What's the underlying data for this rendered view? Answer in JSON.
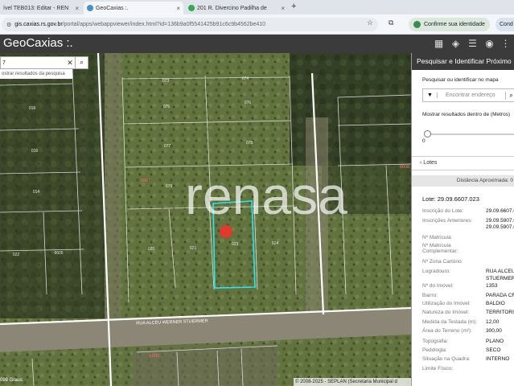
{
  "browser": {
    "tabs": [
      {
        "label": "ível TEB013: Editar - REN"
      },
      {
        "label": "GeoCaxias :."
      },
      {
        "label": "201 R. Divercino Padilha de"
      }
    ],
    "url_domain": "gis.caxias.rs.gov.br",
    "url_path": "/portal/apps/webappviewer/index.html?id=136b9a0f5541425b91c6c9b4562be410",
    "confirm_identity": "Confirme sua identidade",
    "cond_label": "Cond"
  },
  "app": {
    "title": "GeoCaxias :.",
    "search_value": "7",
    "search_suggestion": "ostrar resultados da pesquisa",
    "copyright": "© 2008-2025 - SEPLAN (Secretaria Municipal d",
    "scale_text": "098 Graus",
    "watermark": "renasa",
    "street_label": "RUA ALCEU WERNER STUERMER",
    "map_labels": [
      "073",
      "074",
      "075",
      "076",
      "077",
      "078",
      "079",
      "6607",
      "020",
      "021",
      "022",
      "023",
      "024",
      "6609",
      "018",
      "016",
      "014",
      "6605",
      "6608"
    ]
  },
  "panel": {
    "title": "Pesquisar e Identificar Próximo",
    "search_label": "Pesquisar ou identificar no mapa",
    "search_placeholder": "Encontrar endereço",
    "distance_label": "Mostrar resultados dentro de (Metros)",
    "slider_value": "0",
    "lotes_label": "Lotes",
    "distance_header": "Distância Aproximada: 0",
    "lote_title": "Lote: 29.09.6607.023",
    "rows": [
      {
        "k": "Inscrição do Lote:",
        "v": "29.09.6607.0"
      },
      {
        "k": "Inscrições Anteriores:",
        "v": "29.09.5907.0"
      },
      {
        "k": "",
        "v": "29.09.5907.0"
      },
      {
        "k": "Nº Matrícula:",
        "v": ""
      },
      {
        "k": "Nº Matrícula",
        "v": ""
      },
      {
        "k": "Complementar:",
        "v": ""
      },
      {
        "k": "Nº Zona Cartório:",
        "v": ""
      },
      {
        "k": "Logradouro:",
        "v": "RUA ALCEU"
      },
      {
        "k": "",
        "v": "STUERMER"
      },
      {
        "k": "Nº do Imóvel:",
        "v": "1353"
      },
      {
        "k": "Bairro:",
        "v": "PARADA CRI"
      },
      {
        "k": "Utilização do Imóvel:",
        "v": "BALDIO"
      },
      {
        "k": "Natureza do Imóvel:",
        "v": "TERRITORIA"
      },
      {
        "k": "Medida da Testada (m):",
        "v": "12,00"
      },
      {
        "k": "Área do Terreno (m²):",
        "v": "300,00"
      },
      {
        "k": "Topografia:",
        "v": "PLANO"
      },
      {
        "k": "Pedologia:",
        "v": "SECO"
      },
      {
        "k": "Situação na Quadra:",
        "v": "INTERNO"
      },
      {
        "k": "Limite Físico:",
        "v": ""
      }
    ]
  }
}
